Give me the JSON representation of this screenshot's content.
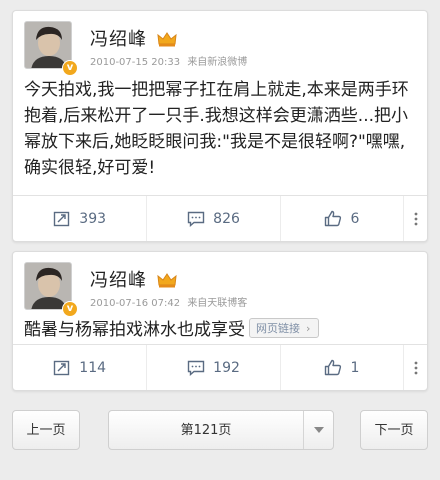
{
  "posts": [
    {
      "username": "冯绍峰",
      "timestamp": "2010-07-15 20:33",
      "source": "来自新浪微博",
      "content": "今天拍戏,我一把把幂子扛在肩上就走,本来是两手环抱着,后来松开了一只手.我想这样会更潇洒些...把小幂放下来后,她眨眨眼问我:\"我是不是很轻啊?\"嘿嘿,确实很轻,好可爱!",
      "reposts": "393",
      "comments": "826",
      "likes": "6"
    },
    {
      "username": "冯绍峰",
      "timestamp": "2010-07-16 07:42",
      "source": "来自天联博客",
      "content": "酷暑与杨幂拍戏淋水也成享受",
      "link_label": "网页链接",
      "reposts": "114",
      "comments": "192",
      "likes": "1"
    }
  ],
  "pager": {
    "prev": "上一页",
    "current": "第121页",
    "next": "下一页"
  },
  "icons": {
    "vip": "vip-badge",
    "crown": "crown-icon",
    "repost": "repost-icon",
    "comment": "comment-icon",
    "like": "thumbs-up-icon",
    "more": "more-vertical-icon",
    "dropdown": "triangle-down-icon"
  },
  "colors": {
    "accent": "#5a6b82",
    "crown": "#f2a81d",
    "background": "#ececec"
  }
}
